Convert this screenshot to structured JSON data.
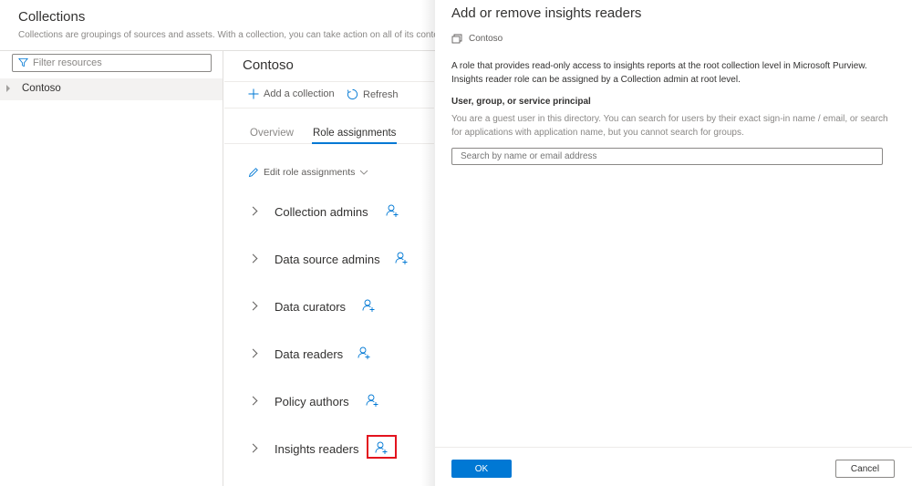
{
  "header": {
    "title": "Collections",
    "subtitle": "Collections are groupings of sources and assets. With a collection, you can take action on all of its content"
  },
  "left_pane": {
    "filter_placeholder": "Filter resources",
    "tree": [
      {
        "label": "Contoso",
        "icon": "caret-right-icon"
      }
    ]
  },
  "main": {
    "title": "Contoso",
    "commands": [
      {
        "label": "Add a collection",
        "icon": "plus-icon"
      },
      {
        "label": "Refresh",
        "icon": "refresh-icon"
      }
    ],
    "tabs": [
      {
        "label": "Overview",
        "active": false
      },
      {
        "label": "Role assignments",
        "active": true
      }
    ],
    "edit_roles_label": "Edit role assignments",
    "roles": [
      {
        "label": "Collection admins"
      },
      {
        "label": "Data source admins"
      },
      {
        "label": "Data curators"
      },
      {
        "label": "Data readers"
      },
      {
        "label": "Policy authors"
      },
      {
        "label": "Insights readers",
        "highlighted": true
      }
    ]
  },
  "panel": {
    "title": "Add or remove insights readers",
    "collection": "Contoso",
    "description": "A role that provides read-only access to insights reports at the root collection level in Microsoft Purview. Insights reader role can be assigned by a Collection admin at root level.",
    "field_label": "User, group, or service principal",
    "help_text": "You are a guest user in this directory. You can search for users by their exact sign-in name / email, or search for applications with application name, but you cannot search for groups.",
    "search_placeholder": "Search by name or email address",
    "ok_label": "OK",
    "cancel_label": "Cancel"
  },
  "colors": {
    "accent": "#0078d4",
    "highlight": "#e3131e"
  }
}
